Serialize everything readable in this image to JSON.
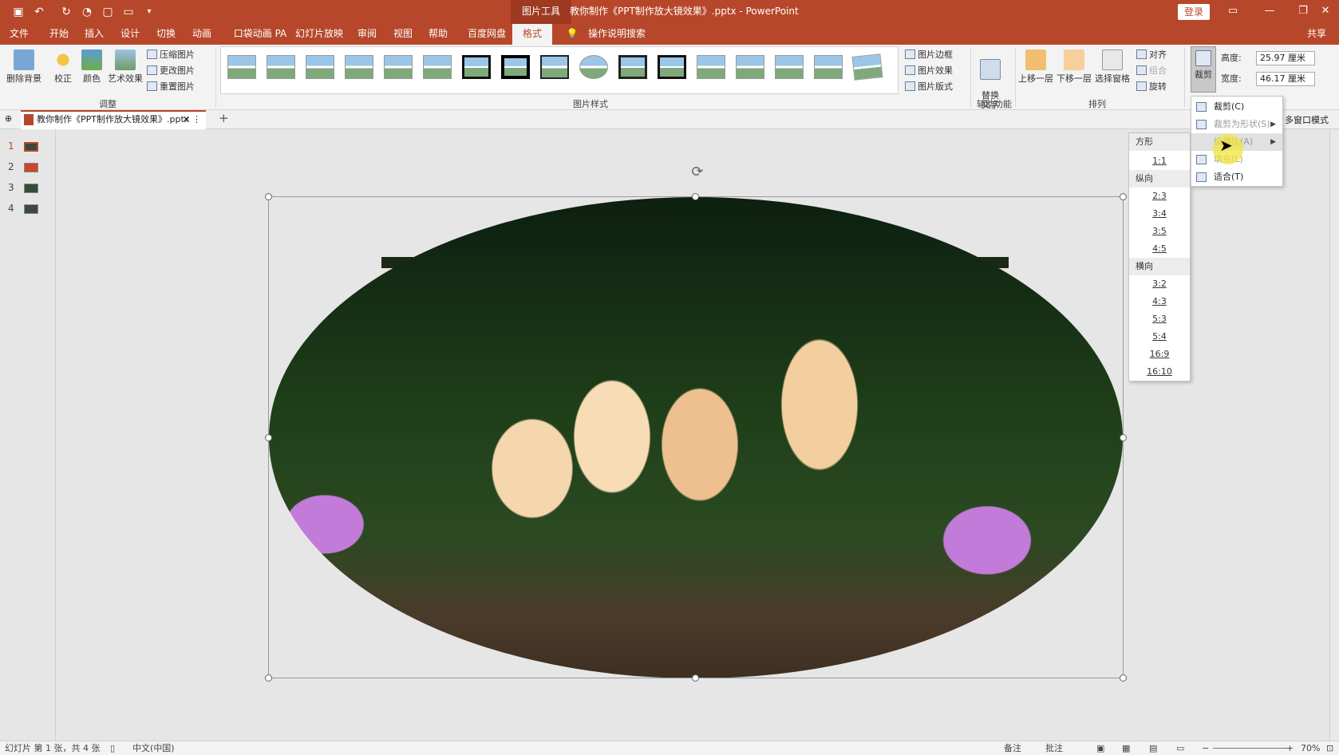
{
  "titlebar": {
    "context_tool": "图片工具",
    "doc_title": "教你制作《PPT制作放大镜效果》.pptx  -  PowerPoint",
    "login": "登录",
    "share": "共享"
  },
  "tabs": [
    {
      "label": "文件"
    },
    {
      "label": "开始"
    },
    {
      "label": "插入"
    },
    {
      "label": "设计"
    },
    {
      "label": "切换"
    },
    {
      "label": "动画"
    },
    {
      "label": "口袋动画 PA"
    },
    {
      "label": "幻灯片放映"
    },
    {
      "label": "审阅"
    },
    {
      "label": "视图"
    },
    {
      "label": "帮助"
    },
    {
      "label": "百度网盘"
    },
    {
      "label": "格式"
    }
  ],
  "tell_me": "操作说明搜索",
  "ribbon": {
    "remove_bg": "删除背景",
    "corrections": "校正",
    "color": "颜色",
    "artistic": "艺术效果",
    "compress": "压缩图片",
    "change": "更改图片",
    "reset": "重置图片",
    "group_adjust": "调整",
    "group_styles": "图片样式",
    "border": "图片边框",
    "effects": "图片效果",
    "layout": "图片版式",
    "alt_text": "替换\n文字",
    "group_access": "辅助功能",
    "bring_forward": "上移一层",
    "send_backward": "下移一层",
    "selection_pane": "选择窗格",
    "align": "对齐",
    "group": "组合",
    "rotate": "旋转",
    "group_arrange": "排列",
    "crop": "裁剪",
    "height_label": "高度:",
    "height_value": "25.97 厘米",
    "width_label": "宽度:",
    "width_value": "46.17 厘米",
    "multiwindow": "多窗口模式"
  },
  "doc_tab": {
    "label": "教你制作《PPT制作放大镜效果》.pptx"
  },
  "slides": [
    {
      "num": "1"
    },
    {
      "num": "2"
    },
    {
      "num": "3"
    },
    {
      "num": "4"
    }
  ],
  "crop_menu": {
    "crop": "裁剪(C)",
    "crop_shape": "裁剪为形状(S)",
    "aspect": "纵横比(A)",
    "fill": "填充(L)",
    "fit": "适合(T)"
  },
  "ratio_menu": {
    "square_head": "方形",
    "square": [
      "1:1"
    ],
    "portrait_head": "纵向",
    "portrait": [
      "2:3",
      "3:4",
      "3:5",
      "4:5"
    ],
    "landscape_head": "横向",
    "landscape": [
      "3:2",
      "4:3",
      "5:3",
      "5:4",
      "16:9",
      "16:10"
    ]
  },
  "status": {
    "slide_info": "幻灯片 第 1 张，共 4 张",
    "language": "中文(中国)",
    "notes": "备注",
    "comments": "批注",
    "zoom": "70%"
  },
  "colors": {
    "accent": "#b7472a"
  }
}
